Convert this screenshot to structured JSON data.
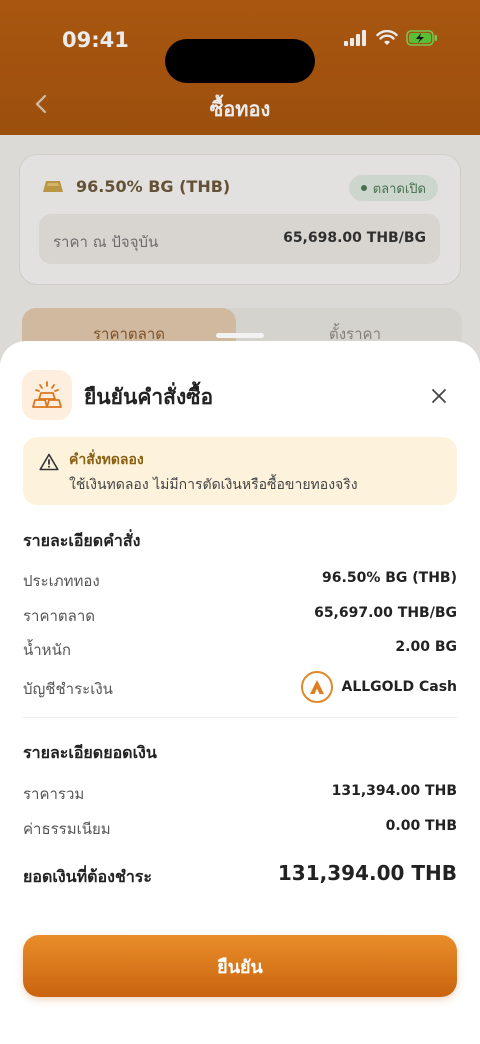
{
  "status_bar": {
    "time": "09:41"
  },
  "header": {
    "title": "ซื้อทอง"
  },
  "background": {
    "card": {
      "gold_type": "96.50% BG (THB)",
      "market_status": "ตลาดเปิด",
      "price_label": "ราคา ณ ปัจจุบัน",
      "price_value": "65,698.00 THB/BG"
    },
    "tabs": [
      {
        "label": "ราคาตลาด"
      },
      {
        "label": "ตั้งราคา"
      }
    ]
  },
  "sheet": {
    "title": "ยืนยันคำสั่งซื้อ",
    "notice": {
      "title": "คำสั่งทดลอง",
      "text": "ใช้เงินทดลอง ไม่มีการตัดเงินหรือซื้อขายทองจริง"
    },
    "order_details": {
      "section_title": "รายละเอียดคำสั่ง",
      "gold_type_label": "ประเภททอง",
      "gold_type_value": "96.50% BG (THB)",
      "market_price_label": "ราคาตลาด",
      "market_price_value": "65,697.00 THB/BG",
      "weight_label": "น้ำหนัก",
      "weight_value": "2.00 BG",
      "account_label": "บัญชีชำระเงิน",
      "account_value": "ALLGOLD Cash"
    },
    "amount_details": {
      "section_title": "รายละเอียดยอดเงิน",
      "subtotal_label": "ราคารวม",
      "subtotal_value": "131,394.00 THB",
      "fee_label": "ค่าธรรมเนียม",
      "fee_value": "0.00 THB",
      "total_label": "ยอดเงินที่ต้องชำระ",
      "total_value": "131,394.00 THB"
    },
    "confirm_label": "ยืนยัน"
  },
  "colors": {
    "header": "#b85f12",
    "accent": "#e07d1f",
    "notice_bg": "#fdf3dc",
    "market_open": "#4f7a57"
  }
}
